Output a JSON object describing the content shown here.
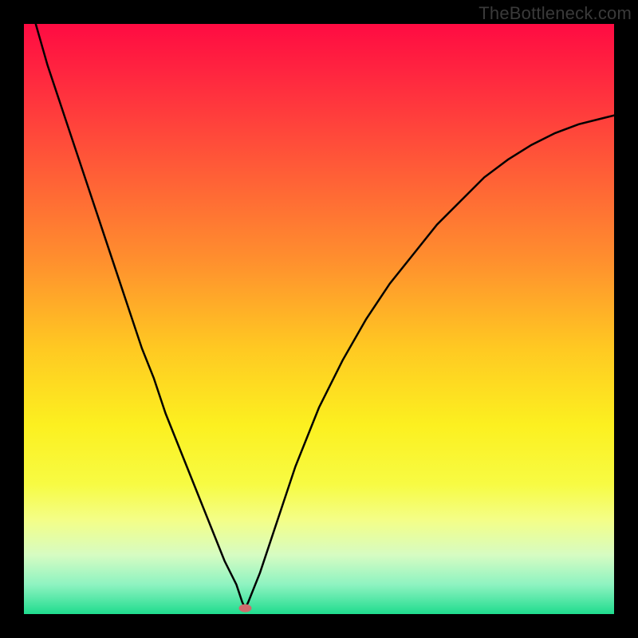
{
  "watermark": "TheBottleneck.com",
  "chart_data": {
    "type": "line",
    "title": "",
    "xlabel": "",
    "ylabel": "",
    "xlim": [
      0,
      100
    ],
    "ylim": [
      0,
      100
    ],
    "x": [
      2,
      4,
      6,
      8,
      10,
      12,
      14,
      16,
      18,
      20,
      22,
      24,
      26,
      28,
      30,
      32,
      34,
      36,
      37,
      37.5,
      38,
      40,
      42,
      44,
      46,
      48,
      50,
      54,
      58,
      62,
      66,
      70,
      74,
      78,
      82,
      86,
      90,
      94,
      98,
      100
    ],
    "values": [
      100,
      93,
      87,
      81,
      75,
      69,
      63,
      57,
      51,
      45,
      40,
      34,
      29,
      24,
      19,
      14,
      9,
      5,
      2,
      1,
      2,
      7,
      13,
      19,
      25,
      30,
      35,
      43,
      50,
      56,
      61,
      66,
      70,
      74,
      77,
      79.5,
      81.5,
      83,
      84,
      84.5
    ],
    "min_point": {
      "x": 37.5,
      "y": 1
    },
    "background_gradient": {
      "stops": [
        {
          "pos": 0,
          "color": "#ff0b42"
        },
        {
          "pos": 50,
          "color": "#ffc922"
        },
        {
          "pos": 100,
          "color": "#1fdc8e"
        }
      ]
    }
  }
}
